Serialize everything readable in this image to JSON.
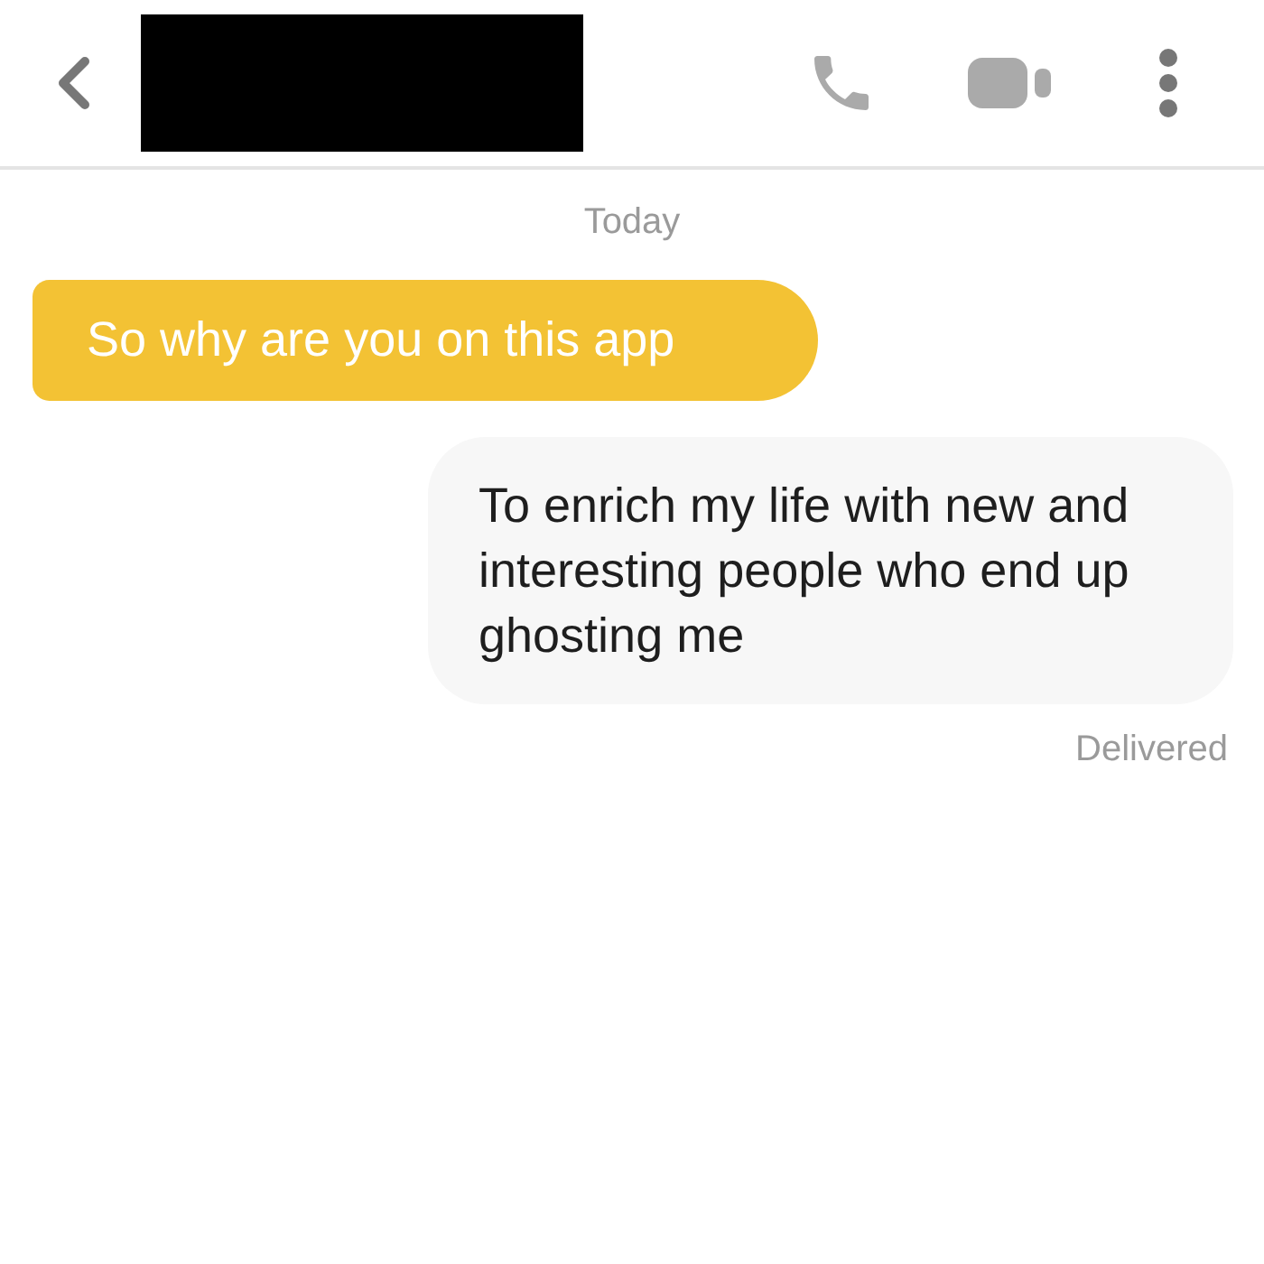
{
  "conversation": {
    "date_label": "Today",
    "messages": [
      {
        "kind": "incoming",
        "text": "So why are you on this app"
      },
      {
        "kind": "outgoing",
        "text": "To enrich my life with new and interesting people who end up ghosting me",
        "status": "Delivered"
      }
    ]
  }
}
